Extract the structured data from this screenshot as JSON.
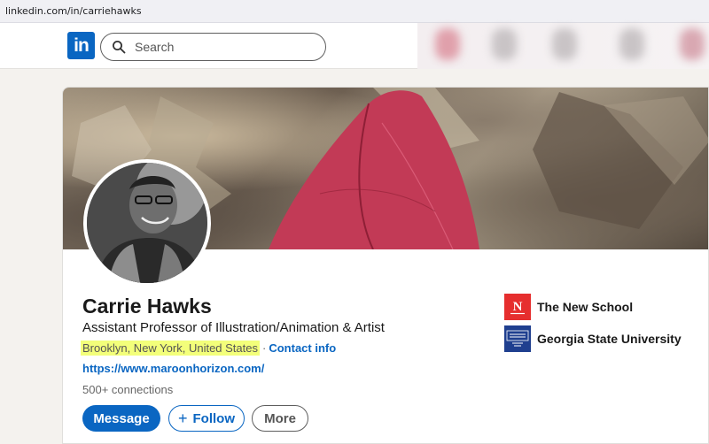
{
  "browser": {
    "url": "linkedin.com/in/carriehawks"
  },
  "header": {
    "logo_text": "in",
    "search_placeholder": "Search",
    "brand_color": "#0a66c2"
  },
  "profile": {
    "name": "Carrie Hawks",
    "headline": "Assistant Professor of Illustration/Animation & Artist",
    "location": "Brooklyn, New York, United States",
    "separator": "·",
    "contact_label": "Contact info",
    "website": "https://www.maroonhorizon.com/",
    "connections": "500+ connections",
    "highlight_color": "#f3ff7a"
  },
  "actions": {
    "message_label": "Message",
    "follow_label": "Follow",
    "follow_icon": "+",
    "more_label": "More"
  },
  "education": [
    {
      "name": "The New School",
      "logo_letter": "N",
      "logo_color": "#e62e2e"
    },
    {
      "name": "Georgia State University",
      "logo_color": "#1f3f8f"
    }
  ]
}
